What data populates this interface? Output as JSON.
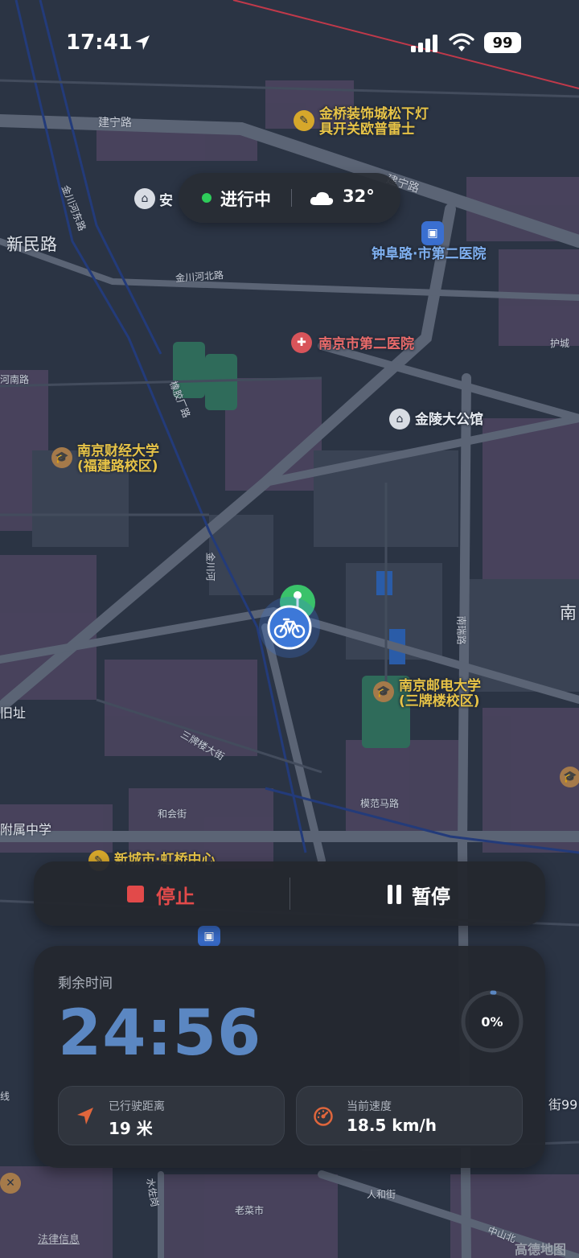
{
  "status_bar": {
    "time": "17:41",
    "battery": "99"
  },
  "status_pill": {
    "status_text": "进行中",
    "temperature": "32°"
  },
  "map": {
    "poi_labels": [
      {
        "text": "金桥装饰城松下灯",
        "color": "yellow"
      },
      {
        "text": "具开关欧普雷士",
        "color": "yellow"
      },
      {
        "text": "钟阜路·市第二医院",
        "color": "blue"
      },
      {
        "text": "南京市第二医院",
        "color": "red"
      },
      {
        "text": "金陵大公馆",
        "color": "white"
      },
      {
        "text": "南京财经大学",
        "color": "yellow"
      },
      {
        "text": "(福建路校区)",
        "color": "yellow"
      },
      {
        "text": "南京邮电大学",
        "color": "yellow"
      },
      {
        "text": "(三牌楼校区)",
        "color": "yellow"
      },
      {
        "text": "安",
        "color": "white"
      },
      {
        "text": "新城市·虹桥中心",
        "color": "yellow"
      }
    ],
    "district_labels": [
      "新民路",
      "南",
      "旧址",
      "附属中学",
      "街99"
    ],
    "road_labels": [
      "建宁路",
      "建宁路",
      "金川河东路",
      "金川河北路",
      "金川河北路",
      "河南路",
      "模范马路",
      "三牌楼大街",
      "和会街",
      "南瑞路",
      "金川河",
      "橡胶厂路",
      "护城",
      "老菜市",
      "人和街",
      "水佐岗",
      "中山北",
      "线"
    ]
  },
  "controls": {
    "stop_label": "停止",
    "pause_label": "暂停"
  },
  "info_card": {
    "remaining_label": "剩余时间",
    "remaining_time": "24:56",
    "progress_text": "0%",
    "progress_fraction": 0.0,
    "distance_label": "已行驶距离",
    "distance_value": "19 米",
    "speed_label": "当前速度",
    "speed_value": "18.5 km/h"
  },
  "footer": {
    "legal_link": "法律信息",
    "watermark": "高德地图"
  },
  "colors": {
    "accent_blue": "#5b87c2",
    "stop_red": "#e24a4a",
    "active_green": "#2ecc5a",
    "map_bg": "#2b3444"
  }
}
